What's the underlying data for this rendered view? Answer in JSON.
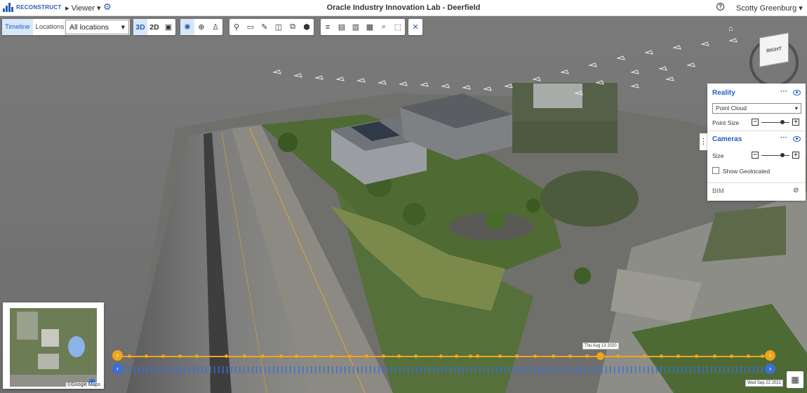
{
  "header": {
    "logo_text": "RECONSTRUCT",
    "viewer_menu": "▸ Viewer ▾",
    "project_title": "Oracle Industry Innovation Lab - Deerfield",
    "help_icon": "?",
    "user_name": "Scotty Greenburg ▾"
  },
  "toolbar": {
    "timeline_tab": "Timeline",
    "locations_tab": "Locations",
    "location_select": "All locations",
    "view_3d": "3D",
    "view_2d": "2D",
    "groups": [
      [
        "image-icon"
      ],
      [
        "orbit-icon",
        "target-icon",
        "walk-icon"
      ],
      [
        "pin-icon",
        "measure-icon",
        "pencil-icon",
        "screen-icon",
        "cube-edit-icon",
        "box-icon"
      ],
      [
        "sort-icon",
        "briefcase-icon",
        "folder-icon",
        "photo-icon",
        "search-icon",
        "select-icon"
      ],
      [
        "close-icon"
      ]
    ]
  },
  "navcube": {
    "home_icon": "home-icon",
    "face_label": "RIGHT"
  },
  "layers_panel": {
    "reality": {
      "title": "Reality",
      "source_select": "Point Cloud",
      "point_size_label": "Point Size",
      "point_size_value": 0.75
    },
    "cameras": {
      "title": "Cameras",
      "size_label": "Size",
      "size_value": 0.75,
      "geolocated_label": "Show Geolocated",
      "geolocated_checked": false
    },
    "bim": {
      "title": "BIM",
      "visible": false
    }
  },
  "minimap": {
    "attribution": "©Google Maps"
  },
  "timeline": {
    "current_label": "Thu Aug 13 2020",
    "end_label": "Wed Sep 22 2021",
    "accent": "#f2a41c",
    "secondary": "#3a6fd8"
  },
  "colors": {
    "brand": "#2a5db0",
    "active": "#1f5fc4"
  }
}
